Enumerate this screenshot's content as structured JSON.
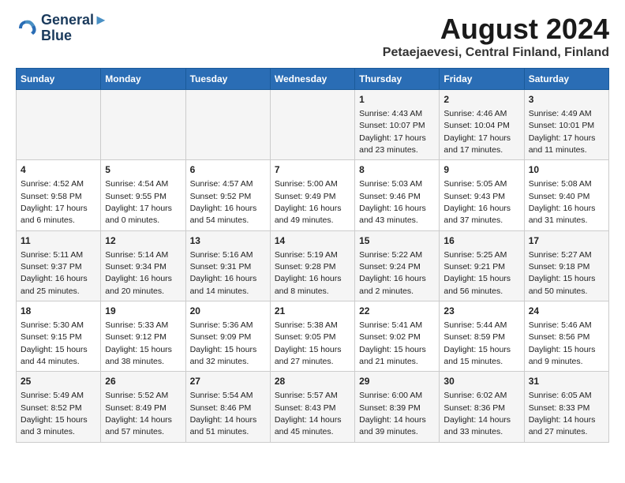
{
  "header": {
    "logo_line1": "General",
    "logo_line2": "Blue",
    "main_title": "August 2024",
    "subtitle": "Petaejaevesi, Central Finland, Finland"
  },
  "days_of_week": [
    "Sunday",
    "Monday",
    "Tuesday",
    "Wednesday",
    "Thursday",
    "Friday",
    "Saturday"
  ],
  "weeks": [
    [
      {
        "day": "",
        "info": ""
      },
      {
        "day": "",
        "info": ""
      },
      {
        "day": "",
        "info": ""
      },
      {
        "day": "",
        "info": ""
      },
      {
        "day": "1",
        "info": "Sunrise: 4:43 AM\nSunset: 10:07 PM\nDaylight: 17 hours\nand 23 minutes."
      },
      {
        "day": "2",
        "info": "Sunrise: 4:46 AM\nSunset: 10:04 PM\nDaylight: 17 hours\nand 17 minutes."
      },
      {
        "day": "3",
        "info": "Sunrise: 4:49 AM\nSunset: 10:01 PM\nDaylight: 17 hours\nand 11 minutes."
      }
    ],
    [
      {
        "day": "4",
        "info": "Sunrise: 4:52 AM\nSunset: 9:58 PM\nDaylight: 17 hours\nand 6 minutes."
      },
      {
        "day": "5",
        "info": "Sunrise: 4:54 AM\nSunset: 9:55 PM\nDaylight: 17 hours\nand 0 minutes."
      },
      {
        "day": "6",
        "info": "Sunrise: 4:57 AM\nSunset: 9:52 PM\nDaylight: 16 hours\nand 54 minutes."
      },
      {
        "day": "7",
        "info": "Sunrise: 5:00 AM\nSunset: 9:49 PM\nDaylight: 16 hours\nand 49 minutes."
      },
      {
        "day": "8",
        "info": "Sunrise: 5:03 AM\nSunset: 9:46 PM\nDaylight: 16 hours\nand 43 minutes."
      },
      {
        "day": "9",
        "info": "Sunrise: 5:05 AM\nSunset: 9:43 PM\nDaylight: 16 hours\nand 37 minutes."
      },
      {
        "day": "10",
        "info": "Sunrise: 5:08 AM\nSunset: 9:40 PM\nDaylight: 16 hours\nand 31 minutes."
      }
    ],
    [
      {
        "day": "11",
        "info": "Sunrise: 5:11 AM\nSunset: 9:37 PM\nDaylight: 16 hours\nand 25 minutes."
      },
      {
        "day": "12",
        "info": "Sunrise: 5:14 AM\nSunset: 9:34 PM\nDaylight: 16 hours\nand 20 minutes."
      },
      {
        "day": "13",
        "info": "Sunrise: 5:16 AM\nSunset: 9:31 PM\nDaylight: 16 hours\nand 14 minutes."
      },
      {
        "day": "14",
        "info": "Sunrise: 5:19 AM\nSunset: 9:28 PM\nDaylight: 16 hours\nand 8 minutes."
      },
      {
        "day": "15",
        "info": "Sunrise: 5:22 AM\nSunset: 9:24 PM\nDaylight: 16 hours\nand 2 minutes."
      },
      {
        "day": "16",
        "info": "Sunrise: 5:25 AM\nSunset: 9:21 PM\nDaylight: 15 hours\nand 56 minutes."
      },
      {
        "day": "17",
        "info": "Sunrise: 5:27 AM\nSunset: 9:18 PM\nDaylight: 15 hours\nand 50 minutes."
      }
    ],
    [
      {
        "day": "18",
        "info": "Sunrise: 5:30 AM\nSunset: 9:15 PM\nDaylight: 15 hours\nand 44 minutes."
      },
      {
        "day": "19",
        "info": "Sunrise: 5:33 AM\nSunset: 9:12 PM\nDaylight: 15 hours\nand 38 minutes."
      },
      {
        "day": "20",
        "info": "Sunrise: 5:36 AM\nSunset: 9:09 PM\nDaylight: 15 hours\nand 32 minutes."
      },
      {
        "day": "21",
        "info": "Sunrise: 5:38 AM\nSunset: 9:05 PM\nDaylight: 15 hours\nand 27 minutes."
      },
      {
        "day": "22",
        "info": "Sunrise: 5:41 AM\nSunset: 9:02 PM\nDaylight: 15 hours\nand 21 minutes."
      },
      {
        "day": "23",
        "info": "Sunrise: 5:44 AM\nSunset: 8:59 PM\nDaylight: 15 hours\nand 15 minutes."
      },
      {
        "day": "24",
        "info": "Sunrise: 5:46 AM\nSunset: 8:56 PM\nDaylight: 15 hours\nand 9 minutes."
      }
    ],
    [
      {
        "day": "25",
        "info": "Sunrise: 5:49 AM\nSunset: 8:52 PM\nDaylight: 15 hours\nand 3 minutes."
      },
      {
        "day": "26",
        "info": "Sunrise: 5:52 AM\nSunset: 8:49 PM\nDaylight: 14 hours\nand 57 minutes."
      },
      {
        "day": "27",
        "info": "Sunrise: 5:54 AM\nSunset: 8:46 PM\nDaylight: 14 hours\nand 51 minutes."
      },
      {
        "day": "28",
        "info": "Sunrise: 5:57 AM\nSunset: 8:43 PM\nDaylight: 14 hours\nand 45 minutes."
      },
      {
        "day": "29",
        "info": "Sunrise: 6:00 AM\nSunset: 8:39 PM\nDaylight: 14 hours\nand 39 minutes."
      },
      {
        "day": "30",
        "info": "Sunrise: 6:02 AM\nSunset: 8:36 PM\nDaylight: 14 hours\nand 33 minutes."
      },
      {
        "day": "31",
        "info": "Sunrise: 6:05 AM\nSunset: 8:33 PM\nDaylight: 14 hours\nand 27 minutes."
      }
    ]
  ]
}
